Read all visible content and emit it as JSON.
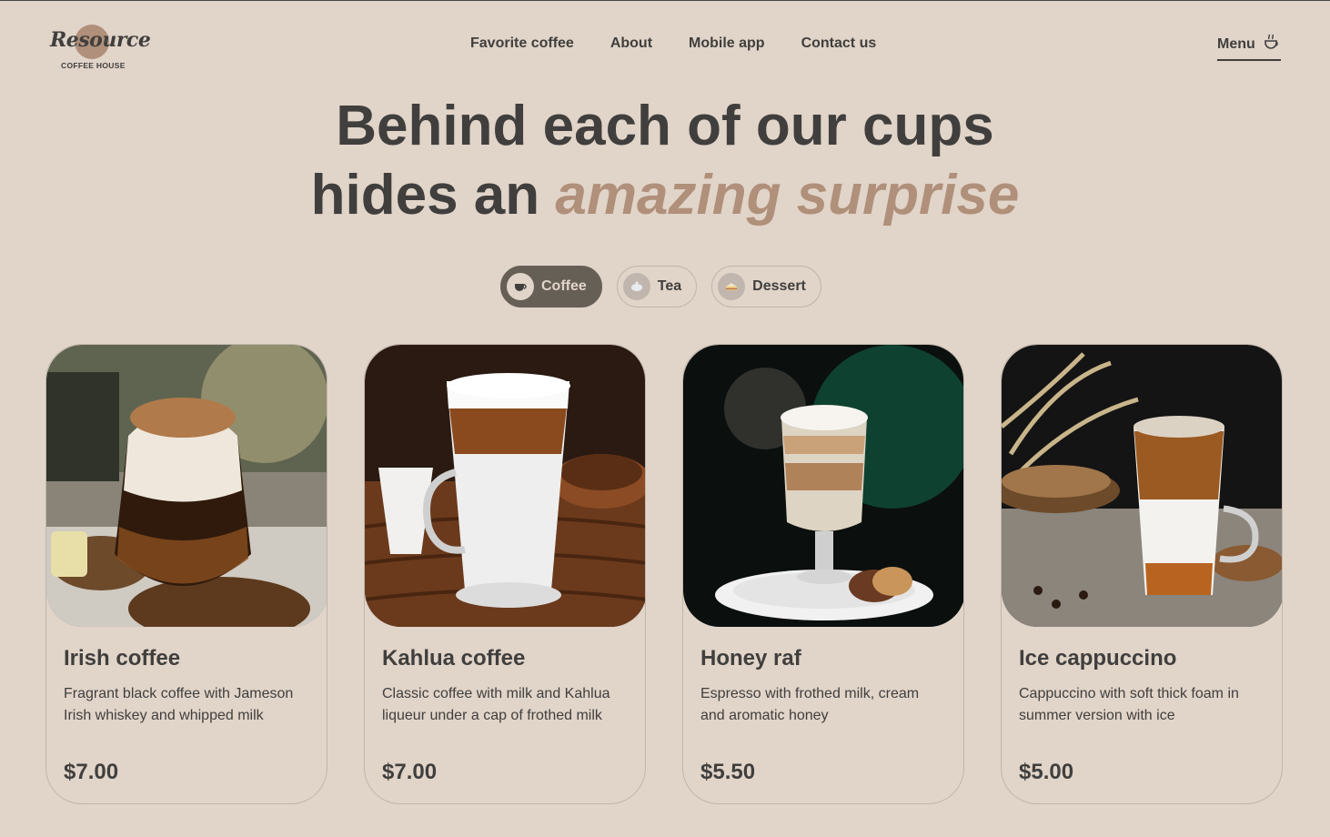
{
  "brand": {
    "name": "Resource",
    "subtitle": "COFFEE HOUSE"
  },
  "nav": {
    "items": [
      "Favorite coffee",
      "About",
      "Mobile app",
      "Contact us"
    ]
  },
  "menu": {
    "label": "Menu",
    "icon": "coffee-cup-icon"
  },
  "hero": {
    "line1": "Behind each of our cups",
    "line2_plain": "hides an ",
    "line2_accent": "amazing surprise"
  },
  "tabs": [
    {
      "label": "Coffee",
      "icon": "coffee-icon",
      "active": true
    },
    {
      "label": "Tea",
      "icon": "tea-icon",
      "active": false
    },
    {
      "label": "Dessert",
      "icon": "dessert-icon",
      "active": false
    }
  ],
  "products": [
    {
      "title": "Irish coffee",
      "description": "Fragrant black coffee with Jameson Irish whiskey and whipped milk",
      "price": "$7.00"
    },
    {
      "title": "Kahlua coffee",
      "description": "Classic coffee with milk and Kahlua liqueur under a cap of frothed milk",
      "price": "$7.00"
    },
    {
      "title": "Honey raf",
      "description": "Espresso with frothed milk, cream and aromatic honey",
      "price": "$5.50"
    },
    {
      "title": "Ice cappuccino",
      "description": "Cappuccino with soft thick foam in summer version with ice",
      "price": "$5.00"
    }
  ],
  "colors": {
    "background": "#e1d4c9",
    "text_dark": "#403f3d",
    "accent": "#b0907a",
    "active_tab": "#665f55",
    "border": "#c1b6ad"
  }
}
